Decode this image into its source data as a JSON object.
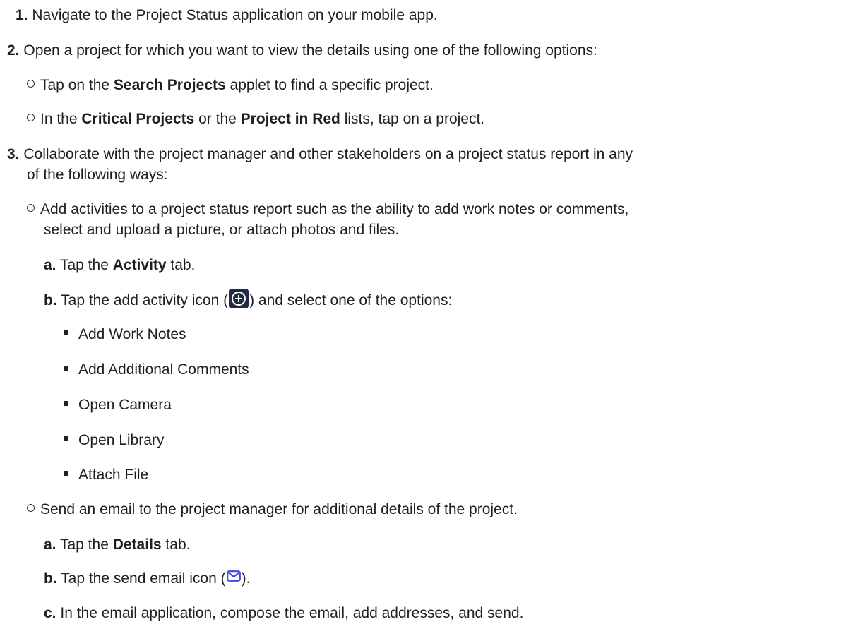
{
  "steps": [
    {
      "number": "1.",
      "text": "Navigate to the Project Status application on your mobile app."
    },
    {
      "number": "2.",
      "text": "Open a project for which you want to view the details using one of the following options:"
    },
    {
      "number": "3.",
      "text_line1": "Collaborate with the project manager and other stakeholders on a project status report in any",
      "text_line2": "of the following ways:"
    }
  ],
  "step2_options": [
    {
      "pre": "Tap on the ",
      "bold": "Search Projects",
      "post": " applet to find a specific project."
    },
    {
      "pre": "In the ",
      "bold": "Critical Projects",
      "mid": " or the ",
      "bold2": "Project in Red",
      "post": " lists, tap on a project."
    }
  ],
  "step3_option1": {
    "line1": "Add activities to a project status report such as the ability to add work notes or comments,",
    "line2": "select and upload a picture, or attach photos and files.",
    "sub_a": {
      "letter": "a.",
      "pre": "Tap the ",
      "bold": "Activity",
      "post": " tab."
    },
    "sub_b": {
      "letter": "b.",
      "pre": "Tap the add activity icon (",
      "post": ") and select one of the options:"
    },
    "options": [
      "Add Work Notes",
      "Add Additional Comments",
      "Open Camera",
      "Open Library",
      "Attach File"
    ]
  },
  "step3_option2": {
    "line1": "Send an email to the project manager for additional details of the project.",
    "sub_a": {
      "letter": "a.",
      "pre": "Tap the ",
      "bold": "Details",
      "post": " tab."
    },
    "sub_b": {
      "letter": "b.",
      "pre": "Tap the send email icon (",
      "post": ")."
    },
    "sub_c": {
      "letter": "c.",
      "text": "In the email application, compose the email, add addresses, and send."
    }
  },
  "icons": {
    "add_activity": "add-circle-icon",
    "send_email": "envelope-icon",
    "add_icon_bg": "#1f2a44",
    "mail_icon_color": "#4a4ae0"
  }
}
